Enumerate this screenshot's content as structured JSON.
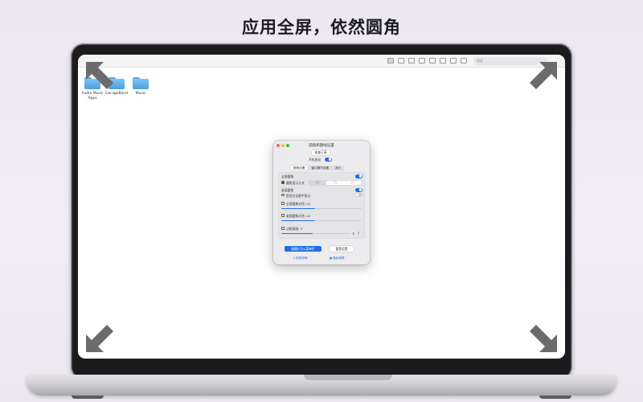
{
  "headline": "应用全屏，依然圆角",
  "finder": {
    "search_placeholder": "搜索",
    "desktop_items": [
      {
        "label": "Audio Music Apps"
      },
      {
        "label": "GarageBand"
      },
      {
        "label": "Music"
      }
    ]
  },
  "settings_window": {
    "title": "圆角和键线设置",
    "restore_label": "恢复订阅",
    "launch_at_login_label": "开机启动",
    "launch_at_login_on": true,
    "tabs": [
      {
        "label": "圆角设置",
        "active": true
      },
      {
        "label": "窗口操作设置",
        "active": false
      },
      {
        "label": "其它",
        "active": false
      }
    ],
    "fullscreen_round_label": "全屏圆角",
    "fullscreen_round_on": true,
    "corner_display_label": "圆角显示方式",
    "corner_display_options": [
      "▢",
      "▢",
      "▢"
    ],
    "desktop_round_label": "桌面圆角",
    "desktop_round_on": true,
    "show_in_fullscreen_label": "是否在全屏中显示",
    "show_in_fullscreen_on": false,
    "fullscreen_radius_label": "全屏圆角半径: 22",
    "fullscreen_radius_value": 22,
    "desktop_radius_label": "桌面圆角半径: 22",
    "desktop_radius_value": 22,
    "border_width_label": "边框厚度: 0",
    "border_width_value": 0,
    "primary_button": "隐藏行为&菜单栏",
    "secondary_button": "重置设置",
    "link_usage": "使用说明",
    "link_feedback": "隐私政策",
    "colors": {
      "accent": "#1f6fe5",
      "traffic_red": "#ff5f57",
      "traffic_yellow": "#febc2e",
      "traffic_green": "#28c840"
    }
  }
}
